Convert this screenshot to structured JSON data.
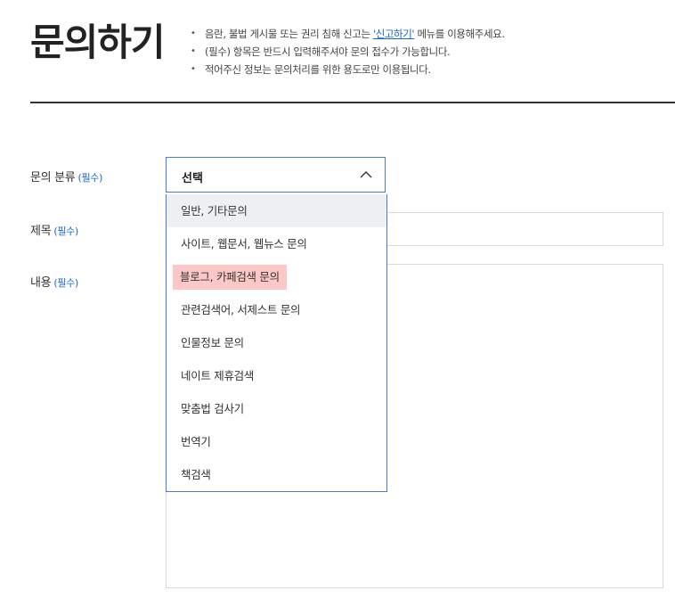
{
  "page_title": "문의하기",
  "notices": {
    "line1_prefix": "음란, 불법 게시물 또는 권리 침해 신고는 ",
    "line1_link": "'신고하기'",
    "line1_suffix": " 메뉴를 이용해주세요.",
    "line2": "(필수) 항목은 반드시 입력해주셔야 문의 접수가 가능합니다.",
    "line3": "적어주신 정보는 문의처리를 위한 용도로만 이용됩니다."
  },
  "form": {
    "category": {
      "label": "문의 분류",
      "required": "(필수)",
      "selected": "선택"
    },
    "title": {
      "label": "제목",
      "required": "(필수)"
    },
    "content": {
      "label": "내용",
      "required": "(필수)"
    }
  },
  "dropdown_options": [
    "일반, 기타문의",
    "사이트, 웹문서, 웹뉴스 문의",
    "블로그, 카페검색 문의",
    "관련검색어, 서제스트 문의",
    "인물정보 문의",
    "네이트 제휴검색",
    "맞춤법 검사기",
    "번역기",
    "책검색"
  ],
  "colors": {
    "accent": "#1a66c9",
    "select_border": "#4a7bd6",
    "hover_bg": "#eef0f2",
    "highlight_bg": "#fbc7c7"
  }
}
